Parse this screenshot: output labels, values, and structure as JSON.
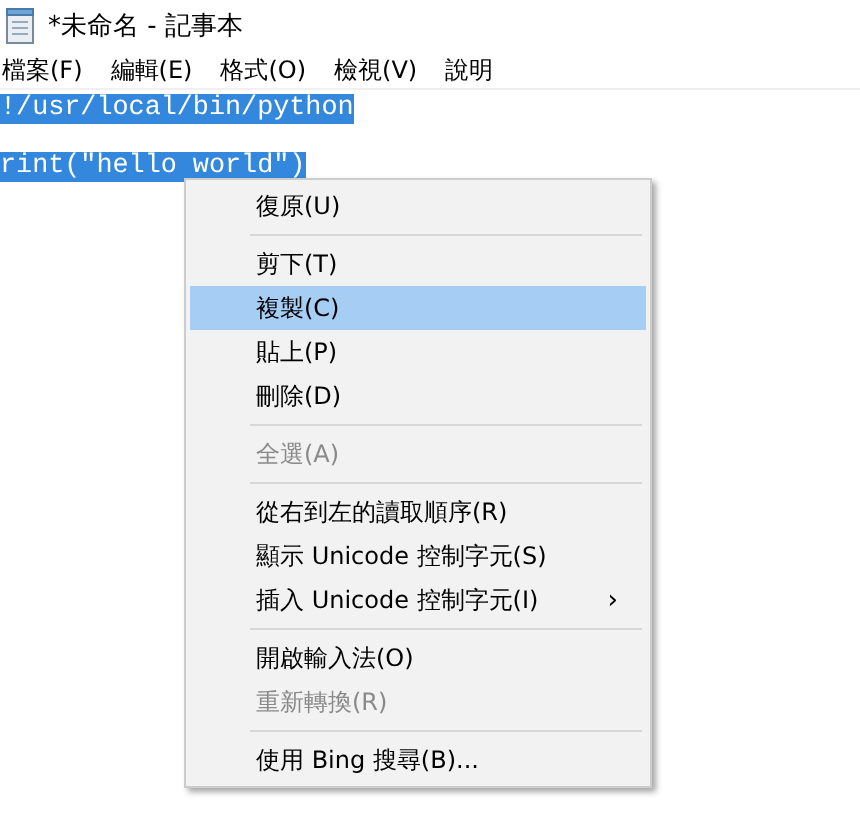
{
  "window": {
    "title": "*未命名 - 記事本"
  },
  "menu_bar": [
    "檔案(F)",
    "編輯(E)",
    "格式(O)",
    "檢視(V)",
    "說明"
  ],
  "editor": {
    "lines": [
      {
        "kind": "code",
        "text": "!/usr/local/bin/python",
        "selected": true
      },
      {
        "kind": "blank"
      },
      {
        "kind": "code",
        "text": "rint(\"hello world\")",
        "selected": true
      }
    ]
  },
  "context_menu": {
    "items": [
      {
        "kind": "item",
        "label": "復原(U)",
        "disabled": false,
        "selected": false
      },
      {
        "kind": "separator"
      },
      {
        "kind": "item",
        "label": "剪下(T)",
        "disabled": false,
        "selected": false
      },
      {
        "kind": "item",
        "label": "複製(C)",
        "disabled": false,
        "selected": true
      },
      {
        "kind": "item",
        "label": "貼上(P)",
        "disabled": false,
        "selected": false
      },
      {
        "kind": "item",
        "label": "刪除(D)",
        "disabled": false,
        "selected": false
      },
      {
        "kind": "separator"
      },
      {
        "kind": "item",
        "label": "全選(A)",
        "disabled": true,
        "selected": false
      },
      {
        "kind": "separator"
      },
      {
        "kind": "item",
        "label": "從右到左的讀取順序(R)",
        "disabled": false,
        "selected": false
      },
      {
        "kind": "item",
        "label": "顯示 Unicode 控制字元(S)",
        "disabled": false,
        "selected": false
      },
      {
        "kind": "item",
        "label": "插入 Unicode 控制字元(I)",
        "disabled": false,
        "selected": false,
        "submenu": "›"
      },
      {
        "kind": "separator"
      },
      {
        "kind": "item",
        "label": "開啟輸入法(O)",
        "disabled": false,
        "selected": false
      },
      {
        "kind": "item",
        "label": "重新轉換(R)",
        "disabled": true,
        "selected": false
      },
      {
        "kind": "separator"
      },
      {
        "kind": "item",
        "label": "使用 Bing 搜尋(B)...",
        "disabled": false,
        "selected": false
      }
    ]
  }
}
